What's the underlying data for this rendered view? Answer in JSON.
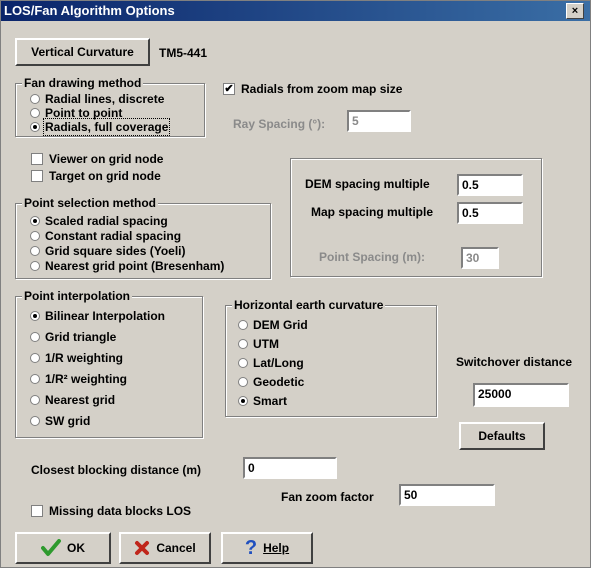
{
  "window": {
    "title": "LOS/Fan Algorithm Options",
    "close": "×"
  },
  "vertical_curvature": {
    "button": "Vertical Curvature",
    "value": "TM5-441"
  },
  "fan": {
    "title": "Fan drawing method",
    "options": [
      "Radial lines, discrete",
      "Point to point",
      "Radials, full coverage"
    ],
    "selected": 2
  },
  "radials_zoom": {
    "label": "Radials from zoom map size",
    "checked": true,
    "mark": "✔"
  },
  "ray_spacing": {
    "label": "Ray Spacing (°):",
    "value": "5"
  },
  "viewer_grid": {
    "label": "Viewer on grid node"
  },
  "target_grid": {
    "label": "Target on grid node"
  },
  "point_selection": {
    "title": "Point selection method",
    "options": [
      "Scaled radial spacing",
      "Constant radial spacing",
      "Grid square sides (Yoeli)",
      "Nearest grid point (Bresenham)"
    ],
    "selected": 0
  },
  "dem_spacing": {
    "label": "DEM spacing multiple",
    "value": "0.5"
  },
  "map_spacing": {
    "label": "Map spacing multiple",
    "value": "0.5"
  },
  "point_spacing": {
    "label": "Point Spacing (m):",
    "value": "30"
  },
  "interp": {
    "title": "Point interpolation",
    "options": [
      "Bilinear Interpolation",
      "Grid triangle",
      "1/R weighting",
      "1/R² weighting",
      "Nearest grid",
      "SW grid"
    ],
    "selected": 0
  },
  "hcurv": {
    "title": "Horizontal earth curvature",
    "options": [
      "DEM Grid",
      "UTM",
      "Lat/Long",
      "Geodetic",
      "Smart"
    ],
    "selected": 4
  },
  "switchover": {
    "label": "Switchover distance",
    "value": "25000"
  },
  "defaults_btn": "Defaults",
  "closest": {
    "label": "Closest blocking distance (m)",
    "value": "0"
  },
  "fan_zoom": {
    "label": "Fan zoom factor",
    "value": "50"
  },
  "missing": {
    "label": "Missing data blocks LOS"
  },
  "buttons": {
    "ok": "OK",
    "cancel": "Cancel",
    "help": "Help"
  },
  "colors": {
    "titlebar": "#0a246a",
    "face": "#d4d0c8",
    "ok_check": "#2e9a2e",
    "cancel_x": "#c0261b",
    "help_q": "#1f4fbf"
  }
}
